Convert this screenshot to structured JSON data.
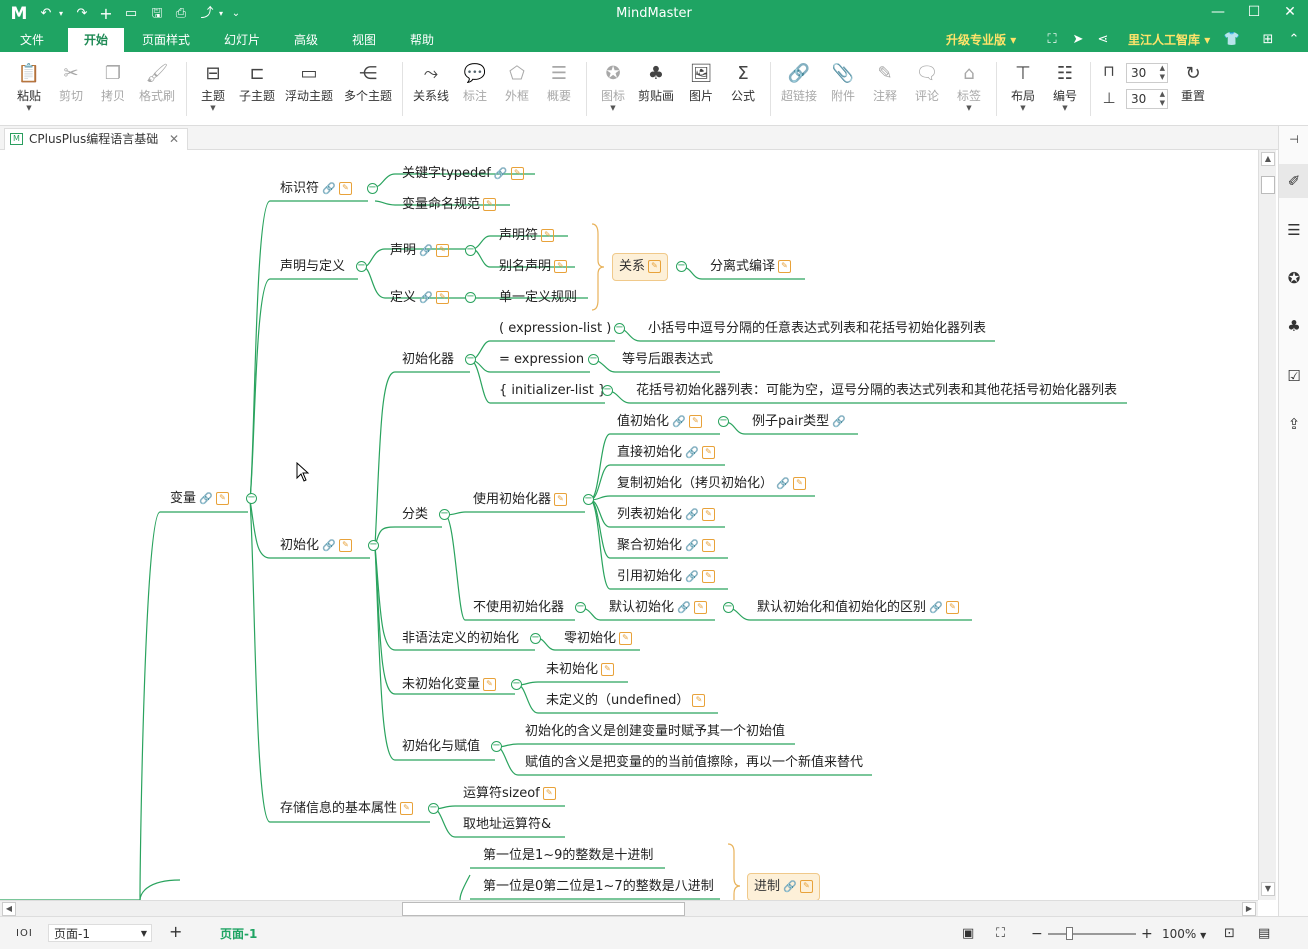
{
  "app": {
    "title": "MindMaster"
  },
  "quick_access": [
    "↶",
    "▾",
    "↷",
    "+",
    "▭",
    "🖫",
    "⎙",
    "⤴",
    "▾",
    "⌄"
  ],
  "menu": {
    "tabs": [
      "文件",
      "开始",
      "页面样式",
      "幻灯片",
      "高级",
      "视图",
      "帮助"
    ],
    "active": "开始",
    "upgrade": "升级专业版",
    "library": "里江人工智库"
  },
  "ribbon": {
    "paste": "粘贴",
    "cut": "剪切",
    "copy": "拷贝",
    "format_painter": "格式刷",
    "topic": "主题",
    "subtopic": "子主题",
    "float_topic": "浮动主题",
    "multi_topic": "多个主题",
    "relation": "关系线",
    "callout": "标注",
    "boundary": "外框",
    "summary": "概要",
    "icon": "图标",
    "clipart": "剪贴画",
    "image": "图片",
    "formula": "公式",
    "hyperlink": "超链接",
    "attachment": "附件",
    "note": "注释",
    "comment": "评论",
    "tag": "标签",
    "layout": "布局",
    "numbering": "编号",
    "h_spacing": "30",
    "v_spacing": "30",
    "reset": "重置"
  },
  "doc_tab": {
    "name": "CPlusPlus编程语言基础"
  },
  "mindmap": {
    "var": "变量",
    "ident": "标识符",
    "typedef": "关键字typedef",
    "naming": "变量命名规范",
    "decl_def": "声明与定义",
    "decl": "声明",
    "declarator": "声明符",
    "alias": "别名声明",
    "def": "定义",
    "odr": "单一定义规则",
    "relation": "关系",
    "separate": "分离式编译",
    "initializer": "初始化器",
    "paren": "( expression-list )",
    "paren_desc": "小括号中逗号分隔的任意表达式列表和花括号初始化器列表",
    "eq": "= expression",
    "eq_desc": "等号后跟表达式",
    "brace": "{ initializer-list }",
    "brace_desc": "花括号初始化器列表：可能为空，逗号分隔的表达式列表和其他花括号初始化器列表",
    "init": "初始化",
    "category": "分类",
    "use_init": "使用初始化器",
    "value_init": "值初始化",
    "pair": "例子pair类型",
    "direct_init": "直接初始化",
    "copy_init": "复制初始化（拷贝初始化）",
    "list_init": "列表初始化",
    "aggr_init": "聚合初始化",
    "ref_init": "引用初始化",
    "no_init": "不使用初始化器",
    "default_init": "默认初始化",
    "default_vs_value": "默认初始化和值初始化的区别",
    "non_syntax": "非语法定义的初始化",
    "zero_init": "零初始化",
    "uninit_var": "未初始化变量",
    "uninit": "未初始化",
    "undefined": "未定义的（undefined）",
    "init_assign": "初始化与赋值",
    "init_meaning": "初始化的含义是创建变量时赋予其一个初始值",
    "assign_meaning": "赋值的含义是把变量的的当前值擦除，再以一个新值来替代",
    "storage": "存储信息的基本属性",
    "sizeof": "运算符sizeof",
    "addr": "取地址运算符&",
    "decimal": "第一位是1~9的整数是十进制",
    "octal": "第一位是0第二位是1~7的整数是八进制",
    "radix": "进制"
  },
  "status": {
    "view_icon": "IOI",
    "page_select": "页面-1",
    "add": "+",
    "page_tab": "页面-1",
    "zoom": "100%"
  },
  "colors": {
    "accent": "#1fa463",
    "branch": "#2aa35e",
    "note": "#e8a23a",
    "link": "#4a86d8",
    "box_bg": "#fdf0d8",
    "upgrade": "#ffe36a"
  }
}
